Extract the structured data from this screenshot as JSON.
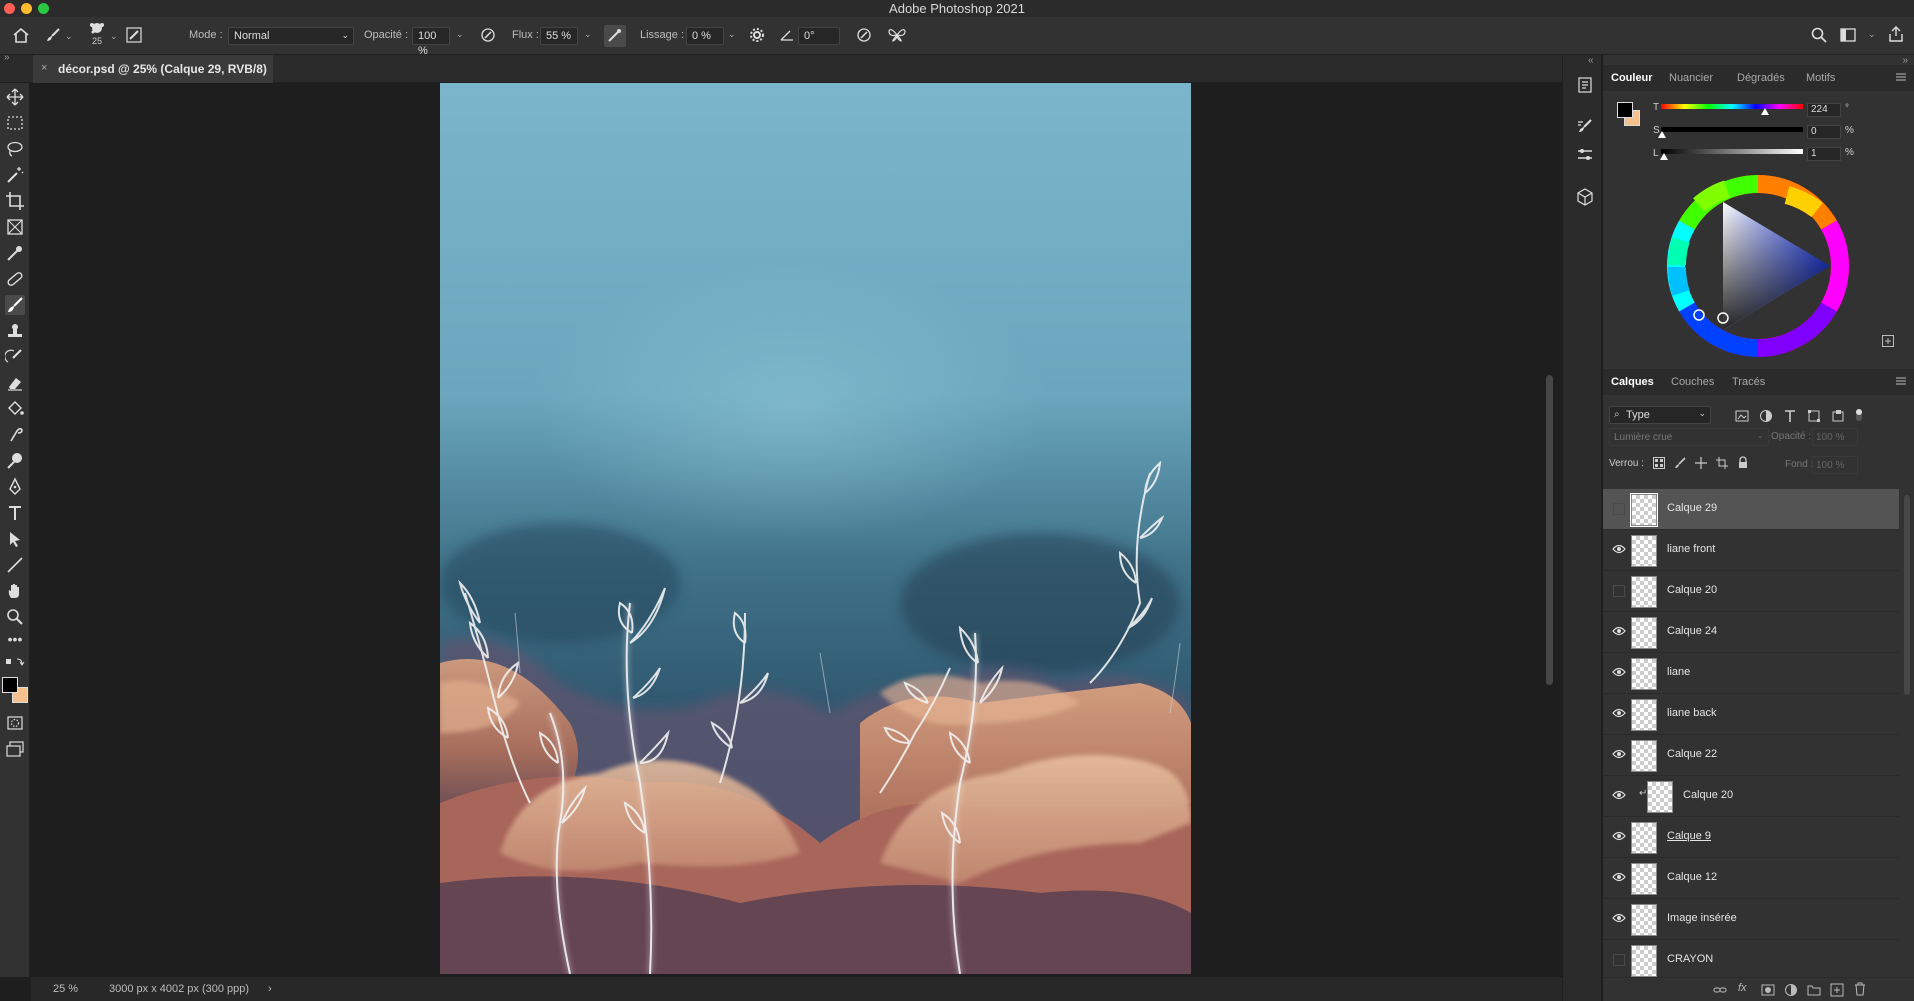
{
  "app": {
    "title": "Adobe Photoshop 2021"
  },
  "options": {
    "brush_size": "25",
    "mode_label": "Mode :",
    "mode_value": "Normal",
    "opacity_label": "Opacité :",
    "opacity_value": "100 %",
    "flow_label": "Flux :",
    "flow_value": "55 %",
    "smoothing_label": "Lissage :",
    "smoothing_value": "0 %",
    "angle_value": "0°"
  },
  "document": {
    "tab_title": "décor.psd @ 25% (Calque 29, RVB/8)",
    "close_glyph": "×"
  },
  "status": {
    "zoom": "25 %",
    "doc_info": "3000 px x 4002 px (300 ppp)",
    "arrow": "›"
  },
  "color_panel": {
    "tabs": [
      "Couleur",
      "Nuancier",
      "Dégradés",
      "Motifs"
    ],
    "active_tab": "Couleur",
    "sliders": [
      {
        "label": "T",
        "value": "224",
        "unit": "°"
      },
      {
        "label": "S",
        "value": "0",
        "unit": "%"
      },
      {
        "label": "L",
        "value": "1",
        "unit": "%"
      }
    ],
    "foreground_color": "#000000",
    "background_color": "#f4c08c"
  },
  "layers_panel": {
    "tabs": [
      "Calques",
      "Couches",
      "Tracés"
    ],
    "active_tab": "Calques",
    "filter_value": "Type",
    "blend_mode": "Lumière crue",
    "opacity_label": "Opacité :",
    "opacity_value": "100 %",
    "lock_label": "Verrou :",
    "fill_label": "Fond :",
    "fill_value": "100 %",
    "layers": [
      {
        "name": "Calque 29",
        "visible": false,
        "selected": true
      },
      {
        "name": "liane front",
        "visible": true
      },
      {
        "name": "Calque 20",
        "visible": false
      },
      {
        "name": "Calque 24",
        "visible": true
      },
      {
        "name": "liane",
        "visible": true
      },
      {
        "name": "liane back",
        "visible": true
      },
      {
        "name": "Calque 22",
        "visible": true
      },
      {
        "name": "Calque 20",
        "visible": true,
        "clipped": true
      },
      {
        "name": "Calque 9",
        "visible": true,
        "underlined": true
      },
      {
        "name": "Calque 12",
        "visible": true
      },
      {
        "name": "Image insérée",
        "visible": true
      },
      {
        "name": "CRAYON",
        "visible": false
      }
    ]
  },
  "colors": {
    "panel_bg": "#323232",
    "app_bg": "#1e1e1e",
    "selected_row": "#545454"
  }
}
